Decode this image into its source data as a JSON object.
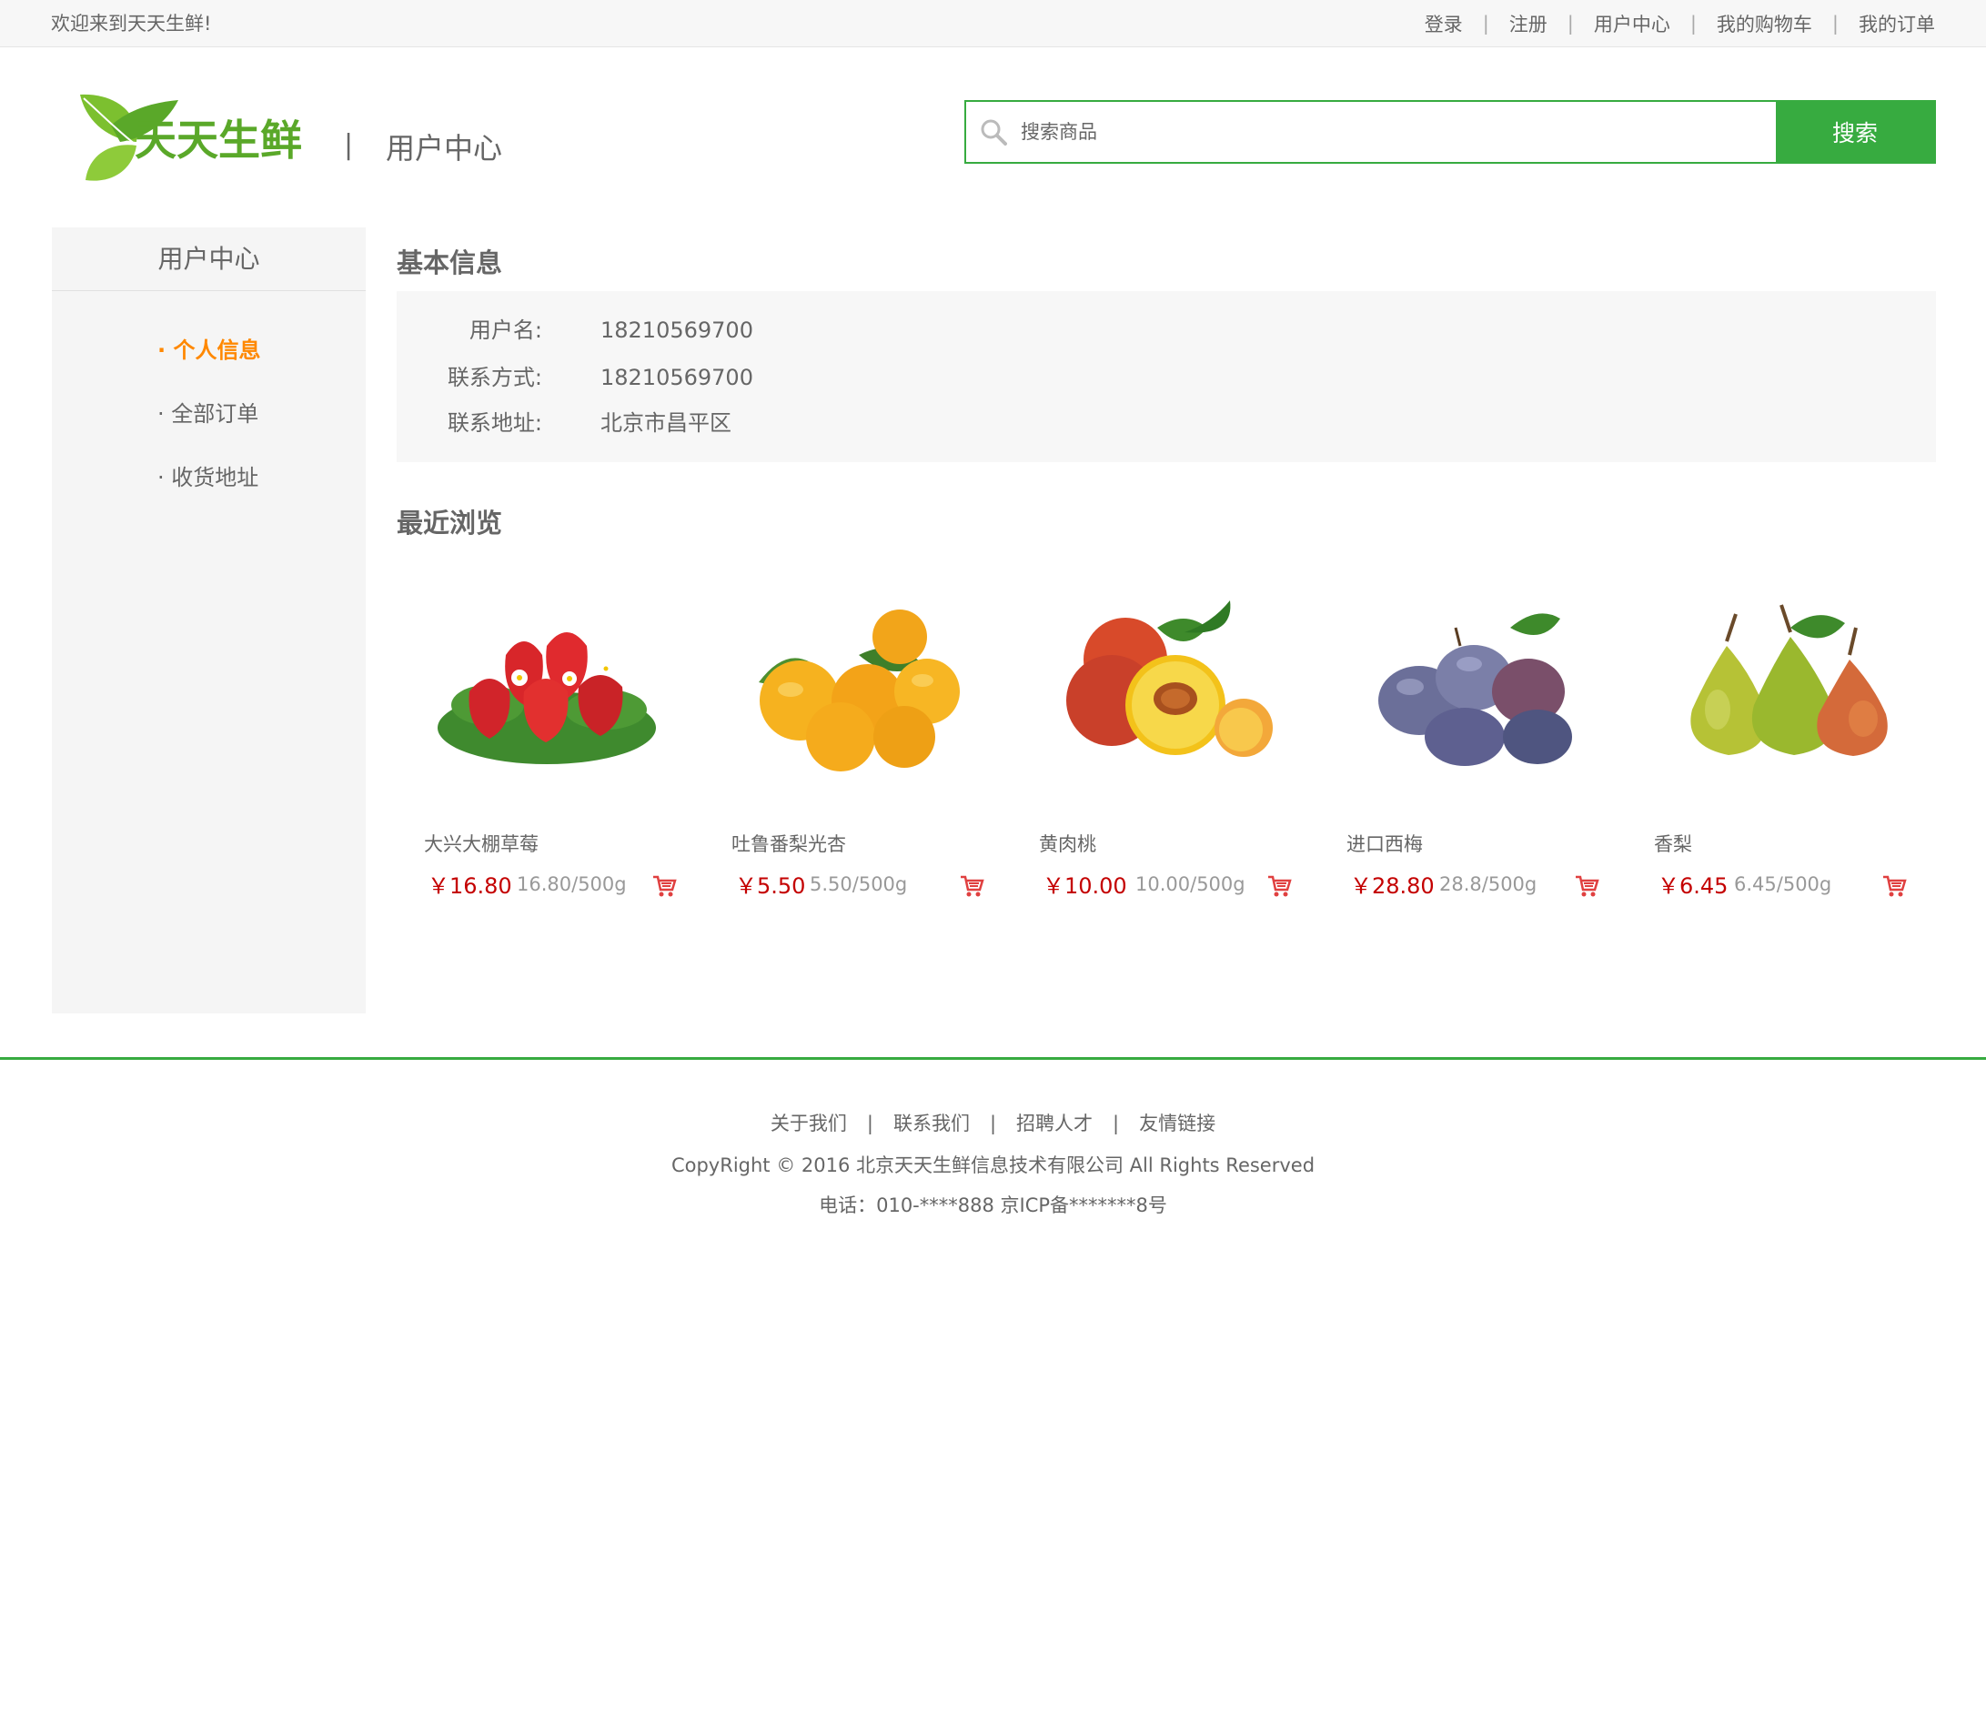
{
  "topbar": {
    "welcome": "欢迎来到天天生鲜!",
    "links": [
      "登录",
      "注册",
      "用户中心",
      "我的购物车",
      "我的订单"
    ]
  },
  "header": {
    "logo_text": "天天生鲜",
    "separator": "|",
    "title": "用户中心",
    "search_placeholder": "搜索商品",
    "search_button": "搜索"
  },
  "sidebar": {
    "title": "用户中心",
    "items": [
      "· 个人信息",
      "· 全部订单",
      "· 收货地址"
    ],
    "active_index": 0
  },
  "info": {
    "title": "基本信息",
    "rows": [
      {
        "label": "用户名:",
        "value": "18210569700"
      },
      {
        "label": "联系方式:",
        "value": "18210569700"
      },
      {
        "label": "联系地址:",
        "value": "北京市昌平区"
      }
    ]
  },
  "recent": {
    "title": "最近浏览",
    "items": [
      {
        "name": "大兴大棚草莓",
        "price": "￥16.80",
        "unit": "16.80/500g",
        "image": "strawberry"
      },
      {
        "name": "吐鲁番梨光杏",
        "price": "￥5.50",
        "unit": "5.50/500g",
        "image": "apricot"
      },
      {
        "name": "黄肉桃",
        "price": "￥10.00",
        "unit": "10.00/500g",
        "image": "peach"
      },
      {
        "name": "进口西梅",
        "price": "￥28.80",
        "unit": "28.8/500g",
        "image": "plum"
      },
      {
        "name": "香梨",
        "price": "￥6.45",
        "unit": "6.45/500g",
        "image": "pear"
      }
    ]
  },
  "footer": {
    "links": [
      "关于我们",
      "联系我们",
      "招聘人才",
      "友情链接"
    ],
    "copyright": "CopyRight © 2016 北京天天生鲜信息技术有限公司 All Rights Reserved",
    "tel": "电话：010-****888 京ICP备*******8号"
  },
  "colors": {
    "brand_green": "#37ab40",
    "active_orange": "#ff8800",
    "price_red": "#c40000"
  },
  "icons": {
    "search": "search-icon",
    "cart": "cart-icon"
  }
}
